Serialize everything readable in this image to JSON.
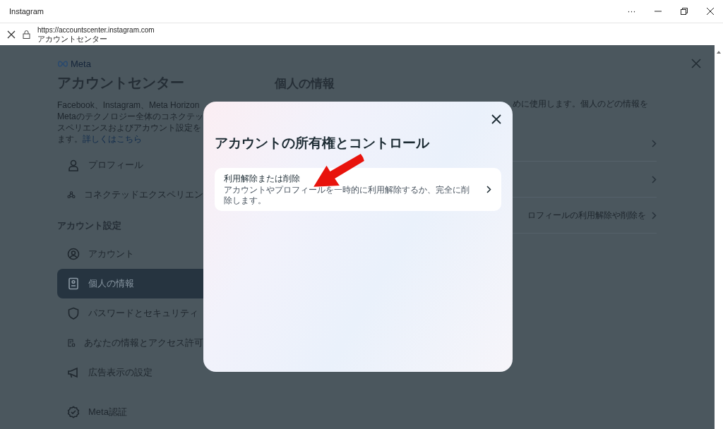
{
  "window": {
    "title": "Instagram",
    "menu": "···"
  },
  "address": {
    "url": "https://accountscenter.instagram.com",
    "page_title": "アカウントセンター"
  },
  "sidebar": {
    "brand": "Meta",
    "title": "アカウントセンター",
    "intro_lines": [
      "Facebook、Instagram、Meta Horizon",
      "Metaのテクノロジー全体のコネクテッ",
      "スペリエンスおよびアカウント設定を"
    ],
    "intro_last": "ます。",
    "intro_link": "詳しくはこちら",
    "items": [
      {
        "kind": "person",
        "label": "プロフィール",
        "selected": false
      },
      {
        "kind": "network",
        "label": "コネクテッドエクスペリエン",
        "selected": false
      }
    ],
    "section": "アカウント設定",
    "settings": [
      {
        "kind": "account",
        "label": "アカウント",
        "selected": false
      },
      {
        "kind": "card",
        "label": "個人の情報",
        "selected": true
      },
      {
        "kind": "shield",
        "label": "パスワードとセキュリティ",
        "selected": false
      },
      {
        "kind": "doc",
        "label": "あなたの情報とアクセス許可",
        "selected": false
      },
      {
        "kind": "megaphone",
        "label": "広告表示の設定",
        "selected": false
      }
    ],
    "footer_item": {
      "kind": "badge",
      "label": "Meta認証",
      "selected": false
    }
  },
  "main": {
    "title": "個人の情報",
    "description": "めに使用します。個人のどの情報を",
    "rows": [
      {
        "label": ""
      },
      {
        "label": ""
      },
      {
        "label": "ロフィールの利用解除や削除を"
      }
    ]
  },
  "dialog": {
    "title": "アカウントの所有権とコントロール",
    "options": [
      {
        "title": "利用解除または削除",
        "description": "アカウントやプロフィールを一時的に利用解除するか、完全に削除します。"
      }
    ]
  }
}
